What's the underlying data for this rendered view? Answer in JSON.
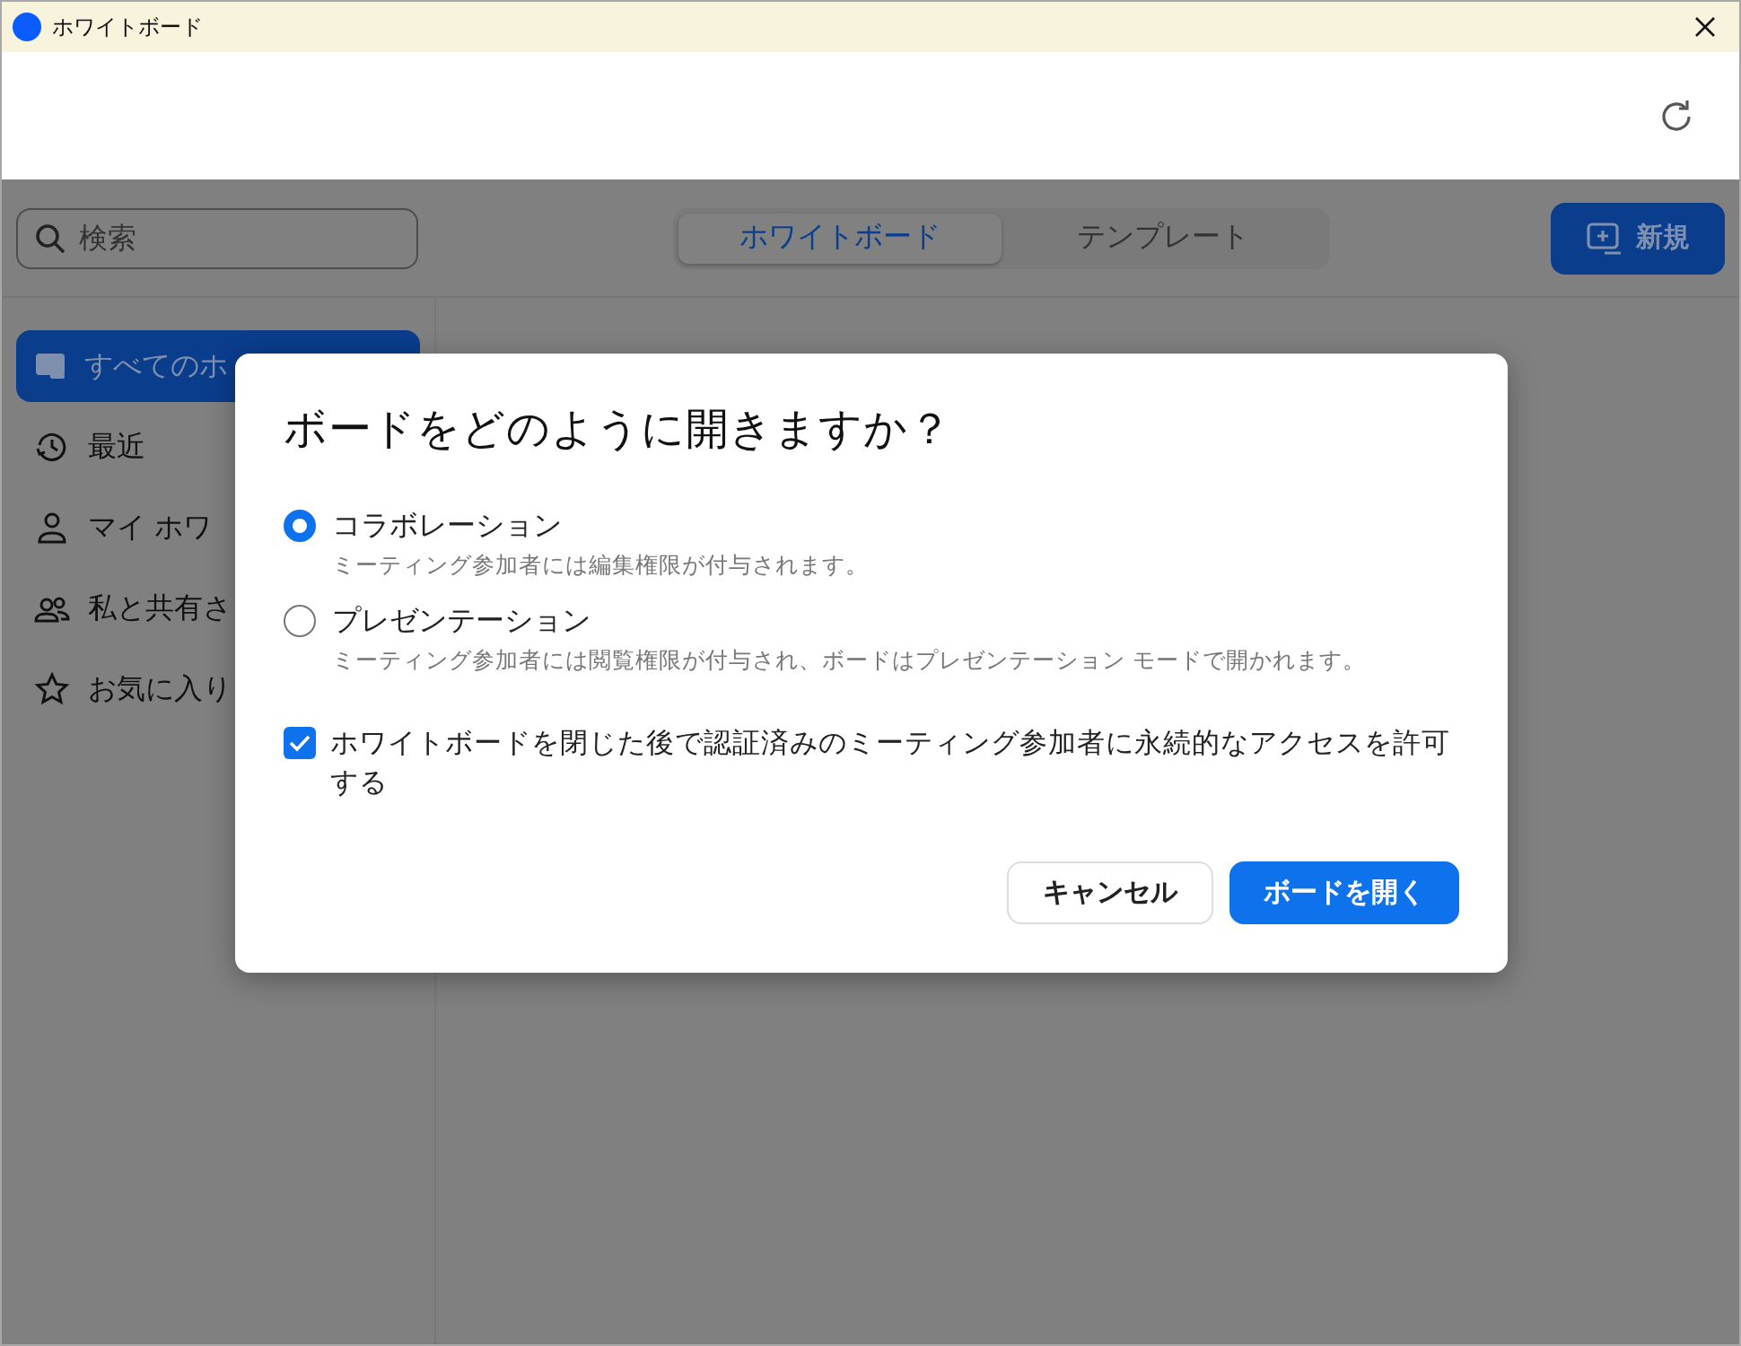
{
  "window": {
    "title": "ホワイトボード"
  },
  "search": {
    "placeholder": "検索"
  },
  "tabs": [
    {
      "label": "ホワイトボード",
      "selected": true
    },
    {
      "label": "テンプレート",
      "selected": false
    }
  ],
  "new_button": {
    "label": "新規"
  },
  "sidebar": {
    "items": [
      {
        "label": "すべてのホ",
        "kind": "board",
        "selected": true
      },
      {
        "label": "最近",
        "kind": "clock",
        "selected": false
      },
      {
        "label": "マイ ホワ",
        "kind": "person",
        "selected": false
      },
      {
        "label": "私と共有さ",
        "kind": "people",
        "selected": false
      },
      {
        "label": "お気に入り",
        "kind": "star",
        "selected": false
      }
    ]
  },
  "dialog": {
    "title": "ボードをどのように開きますか？",
    "options": [
      {
        "label": "コラボレーション",
        "description": "ミーティング参加者には編集権限が付与されます。",
        "selected": true
      },
      {
        "label": "プレゼンテーション",
        "description": "ミーティング参加者には閲覧権限が付与され、ボードはプレゼンテーション モードで開かれます。",
        "selected": false
      }
    ],
    "checkbox": {
      "label": "ホワイトボードを閉じた後で認証済みのミーティング参加者に永続的なアクセスを許可する",
      "checked": true
    },
    "buttons": [
      {
        "label": "キャンセル",
        "kind": "secondary"
      },
      {
        "label": "ボードを開く",
        "kind": "primary"
      }
    ]
  }
}
